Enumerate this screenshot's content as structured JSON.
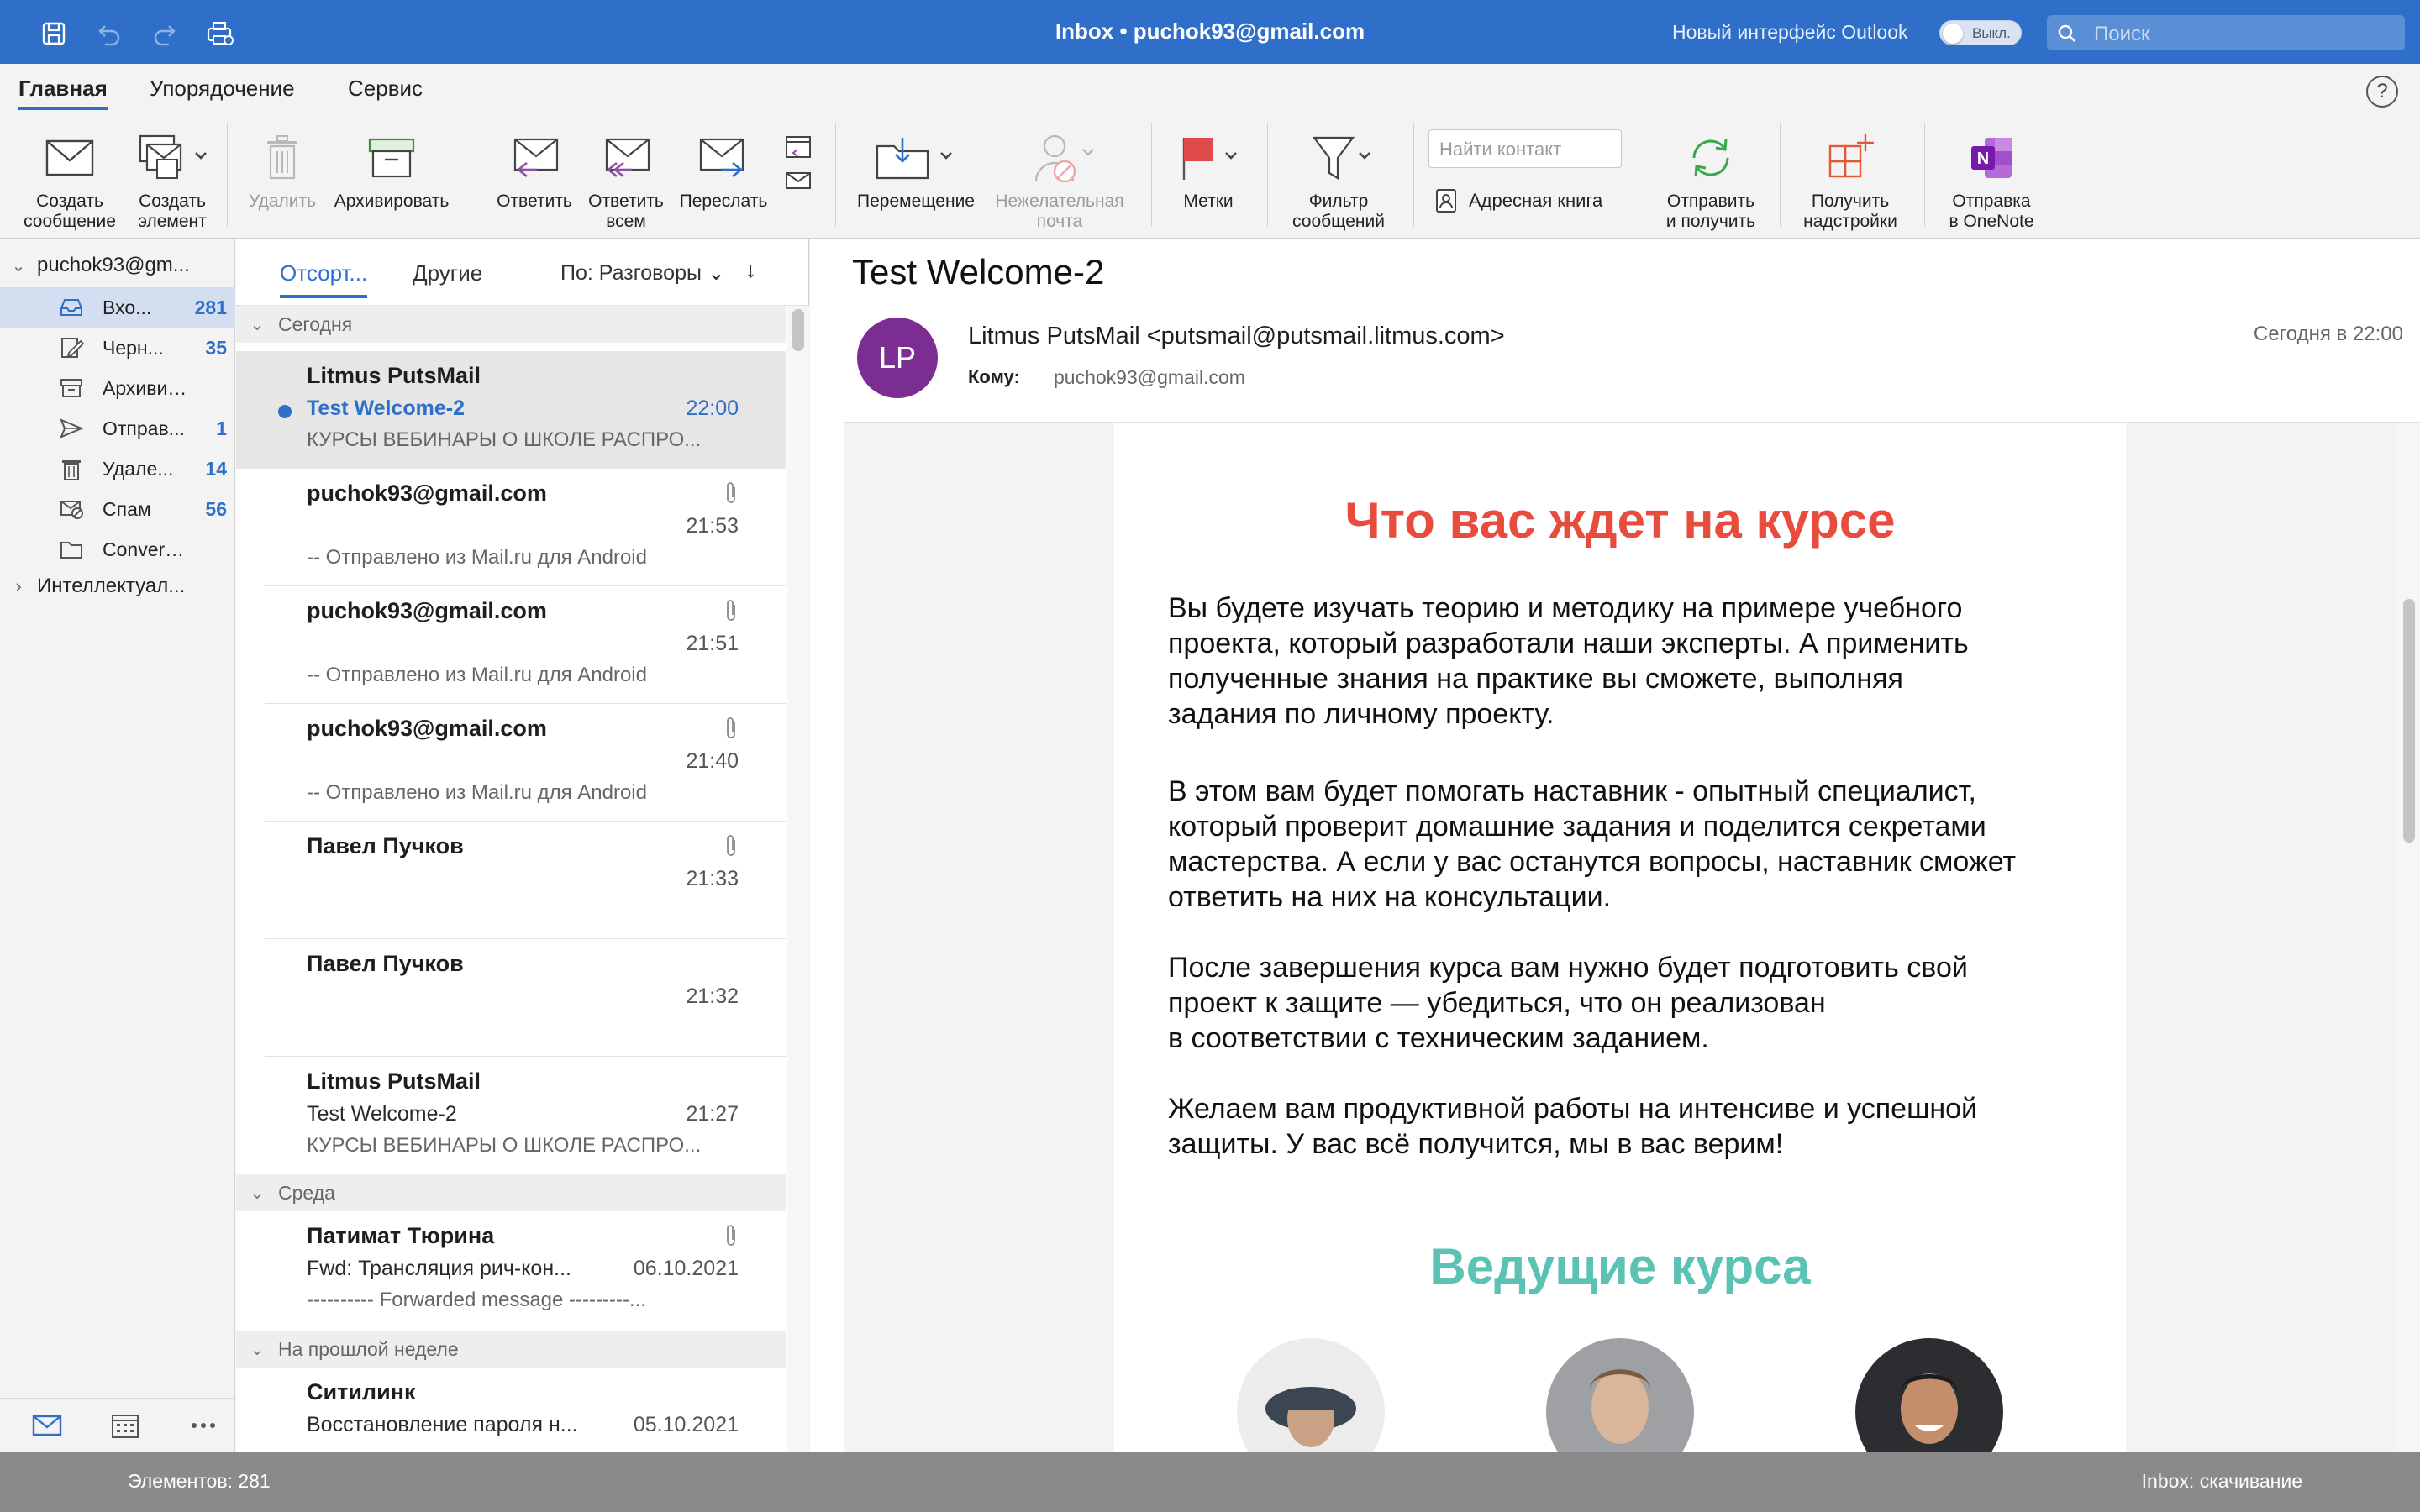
{
  "window": {
    "title": "Inbox • puchok93@gmail.com"
  },
  "topbar": {
    "new_ui_label": "Новый интерфейс Outlook",
    "toggle_label": "Выкл.",
    "search_placeholder": "Поиск"
  },
  "tabs": [
    "Главная",
    "Упорядочение",
    "Сервис"
  ],
  "help_label": "?",
  "ribbon": {
    "new_message": [
      "Создать",
      "сообщение"
    ],
    "new_item": [
      "Создать",
      "элемент"
    ],
    "delete": "Удалить",
    "archive": "Архивировать",
    "reply": "Ответить",
    "reply_all": [
      "Ответить",
      "всем"
    ],
    "forward": "Переслать",
    "move": "Перемещение",
    "junk": [
      "Нежелательная",
      "почта"
    ],
    "flags": "Метки",
    "filter": [
      "Фильтр",
      "сообщений"
    ],
    "contact_placeholder": "Найти контакт",
    "address_book": "Адресная книга",
    "send_receive": [
      "Отправить",
      "и получить"
    ],
    "addins": [
      "Получить",
      "надстройки"
    ],
    "onenote": [
      "Отправка",
      "в OneNote"
    ]
  },
  "folders": {
    "account": "puchok93@gm...",
    "items": [
      {
        "name": "Вхо...",
        "count": "281",
        "icon": "inbox-icon"
      },
      {
        "name": "Черн...",
        "count": "35",
        "icon": "drafts-icon"
      },
      {
        "name": "Архивир...",
        "count": "",
        "icon": "archive-icon"
      },
      {
        "name": "Отправ...",
        "count": "1",
        "icon": "sent-icon"
      },
      {
        "name": "Удале...",
        "count": "14",
        "icon": "trash-icon"
      },
      {
        "name": "Спам",
        "count": "56",
        "icon": "spam-icon"
      },
      {
        "name": "Conversa...",
        "count": "",
        "icon": "folder-icon"
      }
    ],
    "smart_group": "Интеллектуал..."
  },
  "list": {
    "tab_focused": "Отсорт...",
    "tab_other": "Другие",
    "sort_label": "По: Разговоры",
    "groups": [
      "Сегодня",
      "Среда",
      "На прошлой неделе"
    ],
    "messages": [
      {
        "from": "Litmus PutsMail",
        "subject": "Test Welcome-2",
        "time": "22:00",
        "preview": "КУРСЫ ВЕБИНАРЫ О ШКОЛЕ РАСПРО..."
      },
      {
        "from": "puchok93@gmail.com",
        "subject": "",
        "time": "21:53",
        "preview": "-- Отправлено из Mail.ru для Android"
      },
      {
        "from": "puchok93@gmail.com",
        "subject": "",
        "time": "21:51",
        "preview": "-- Отправлено из Mail.ru для Android"
      },
      {
        "from": "puchok93@gmail.com",
        "subject": "",
        "time": "21:40",
        "preview": "-- Отправлено из Mail.ru для Android"
      },
      {
        "from": "Павел Пучков",
        "subject": "",
        "time": "21:33",
        "preview": ""
      },
      {
        "from": "Павел Пучков",
        "subject": "",
        "time": "21:32",
        "preview": ""
      },
      {
        "from": "Litmus PutsMail",
        "subject": "Test Welcome-2",
        "time": "21:27",
        "preview": "КУРСЫ ВЕБИНАРЫ О ШКОЛЕ РАСПРО..."
      },
      {
        "from": "Патимат Тюрина",
        "subject": "Fwd: Трансляция рич-кон...",
        "time": "06.10.2021",
        "preview": "---------- Forwarded message ---------..."
      },
      {
        "from": "Ситилинк",
        "subject": "Восстановление пароля н...",
        "time": "05.10.2021",
        "preview": ""
      }
    ]
  },
  "reader": {
    "subject": "Test Welcome-2",
    "avatar_initials": "LP",
    "from": "Litmus PutsMail <putsmail@putsmail.litmus.com>",
    "to_label": "Кому:",
    "to": "puchok93@gmail.com",
    "date": "Сегодня в 22:00",
    "heading1": "Что вас ждет на курсе",
    "p1": [
      "Вы будете изучать теорию и методику на примере учебного",
      "проекта, который разработали наши эксперты. А применить",
      "полученные знания на практике вы сможете, выполняя",
      "задания по личному проекту."
    ],
    "p2": [
      "В этом вам будет помогать наставник - опытный специалист,",
      "который проверит домашние задания и поделится секретами",
      "мастерства. А если у вас останутся вопросы, наставник сможет",
      "ответить на них на консультации."
    ],
    "p3": [
      "После завершения курса вам нужно будет подготовить свой",
      "проект к защите — убедиться, что он реализован",
      "в соответствии с техническим заданием."
    ],
    "p4": [
      "Желаем вам продуктивной работы на интенсиве и успешной",
      "защиты. У вас всё получится, мы в вас верим!"
    ],
    "heading2": "Ведущие курса"
  },
  "status": {
    "left": "Элементов: 281",
    "right": "Inbox: скачивание"
  },
  "colors": {
    "accent": "#2f6fc9",
    "heading_orange": "#e84c3d",
    "heading_teal": "#5bc2b4",
    "avatar": "#7b2d91"
  }
}
